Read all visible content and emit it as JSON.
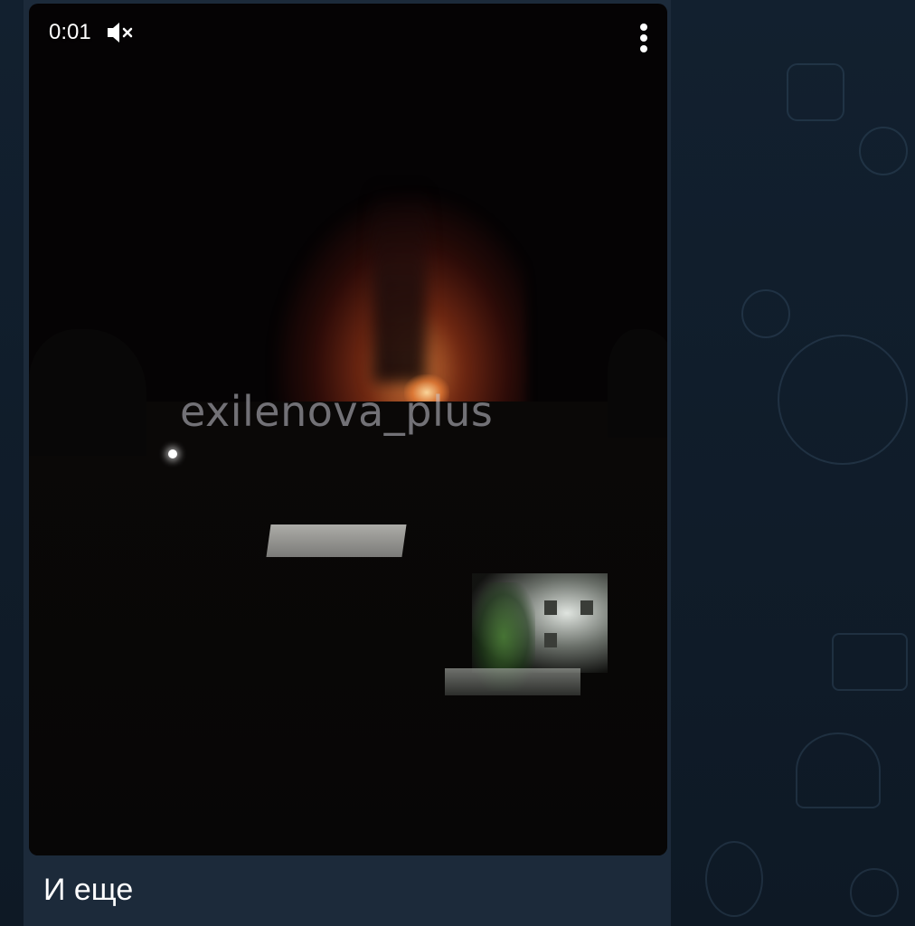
{
  "video": {
    "time_elapsed": "0:01",
    "watermark": "exilenova_plus",
    "muted": true,
    "mute_icon": "speaker-muted-icon",
    "menu_icon": "more-vertical-icon"
  },
  "message": {
    "caption": "И еще"
  },
  "colors": {
    "chat_background": "#0f1a27",
    "bubble_background": "#1c2a3a",
    "text": "#ffffff"
  }
}
